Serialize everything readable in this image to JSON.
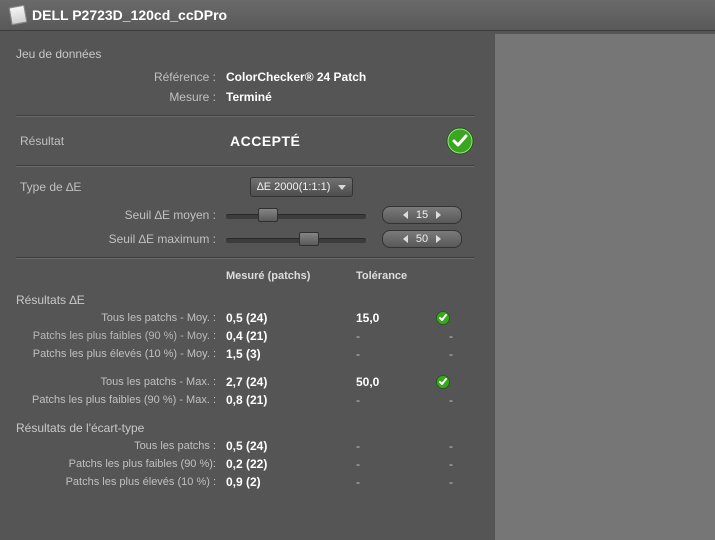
{
  "title": "DELL P2723D_120cd_ccDPro",
  "dataset": {
    "sectionLabel": "Jeu de données",
    "referenceLabel": "Référence :",
    "referenceValue": "ColorChecker® 24 Patch",
    "measureLabel": "Mesure :",
    "measureValue": "Terminé"
  },
  "result": {
    "label": "Résultat",
    "value": "ACCEPTÉ",
    "status": "pass"
  },
  "deltaE": {
    "typeLabel": "Type de ∆E",
    "typeValue": "∆E 2000(1:1:1)",
    "avgThresholdLabel": "Seuil ∆E moyen :",
    "avgThresholdValue": "15",
    "avgThresholdSliderPercent": 26,
    "maxThresholdLabel": "Seuil ∆E maximum :",
    "maxThresholdValue": "50",
    "maxThresholdSliderPercent": 60
  },
  "tableHeaders": {
    "measured": "Mesuré (patchs)",
    "tolerance": "Tolérance"
  },
  "deResults": {
    "section": "Résultats ∆E",
    "rows": [
      {
        "label": "Tous les patchs - Moy. :",
        "measured": "0,5  (24)",
        "tolerance": "15,0",
        "status": "pass"
      },
      {
        "label": "Patchs les plus faibles (90 %) - Moy. :",
        "measured": "0,4  (21)",
        "tolerance": "-",
        "status": "-",
        "tiny": true
      },
      {
        "label": "Patchs les plus élevés (10 %) - Moy. :",
        "measured": "1,5   (3)",
        "tolerance": "-",
        "status": "-"
      },
      {
        "spacer": true
      },
      {
        "label": "Tous les patchs - Max. :",
        "measured": "2,7  (24)",
        "tolerance": "50,0",
        "status": "pass"
      },
      {
        "label": "Patchs les plus faibles (90 %) - Max. :",
        "measured": "0,8  (21)",
        "tolerance": "-",
        "status": "-"
      }
    ]
  },
  "stdResults": {
    "section": "Résultats de l'écart-type",
    "rows": [
      {
        "label": "Tous les patchs :",
        "measured": "0,5  (24)",
        "tolerance": "-",
        "status": "-"
      },
      {
        "label": "Patchs les plus faibles (90 %):",
        "measured": "0,2  (22)",
        "tolerance": "-",
        "status": "-"
      },
      {
        "label": "Patchs les plus élevés (10 %) :",
        "measured": "0,9   (2)",
        "tolerance": "-",
        "status": "-"
      }
    ]
  }
}
